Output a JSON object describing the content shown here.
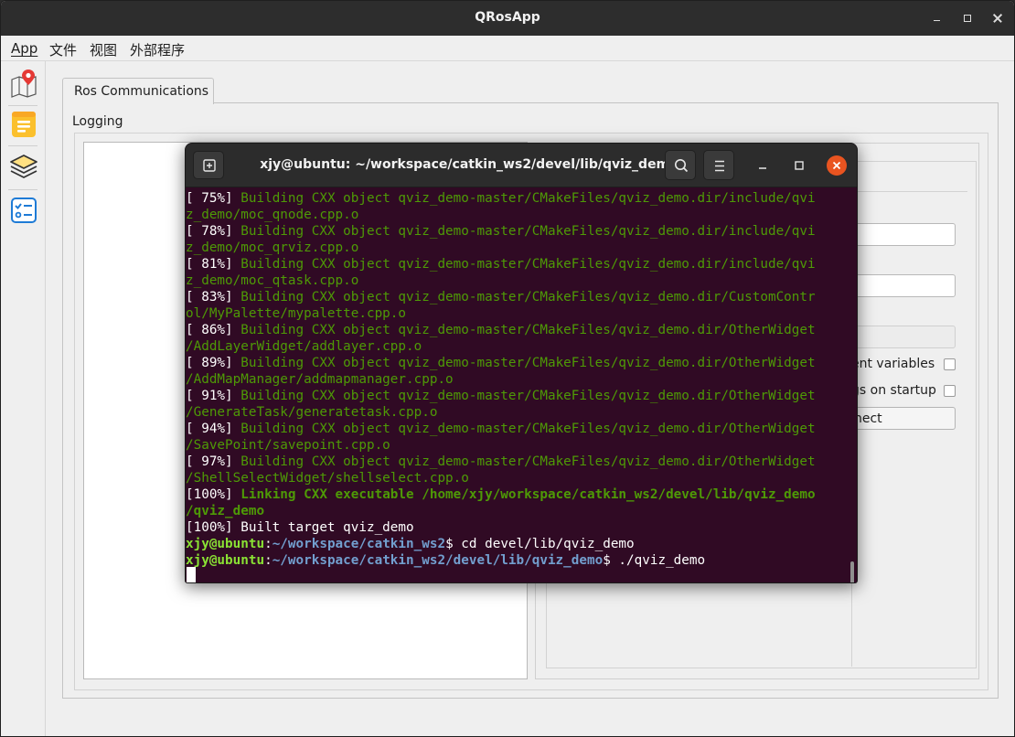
{
  "app": {
    "title": "QRosApp",
    "menu": [
      "App",
      "文件",
      "视图",
      "外部程序"
    ],
    "tab_label": "Ros Communications",
    "logging_label": "Logging",
    "env_checkbox_label": "ent variables",
    "startup_checkbox_label": "gs on startup",
    "connect_label": "nect",
    "env_checked": false,
    "startup_checked": false,
    "toolbar_icons": [
      "map-pin-icon",
      "notes-icon",
      "layers-icon",
      "checklist-icon"
    ],
    "colors": {
      "titlebar": "#2d2d2d",
      "window": "#efefef"
    }
  },
  "terminal": {
    "title": "xjy@ubuntu: ~/workspace/catkin_ws2/devel/lib/qviz_demo",
    "colors": {
      "background": "#300a24",
      "green": "#4e9a06",
      "prompt_user": "#8ae234",
      "prompt_path": "#729fcf",
      "close": "#e95420"
    },
    "lines": [
      [
        {
          "t": "[ 75%] ",
          "c": "w"
        },
        {
          "t": "Building CXX object qviz_demo-master/CMakeFiles/qviz_demo.dir/include/qvi",
          "c": "g"
        }
      ],
      [
        {
          "t": "z_demo/moc_qnode.cpp.o",
          "c": "g"
        }
      ],
      [
        {
          "t": "[ 78%] ",
          "c": "w"
        },
        {
          "t": "Building CXX object qviz_demo-master/CMakeFiles/qviz_demo.dir/include/qvi",
          "c": "g"
        }
      ],
      [
        {
          "t": "z_demo/moc_qrviz.cpp.o",
          "c": "g"
        }
      ],
      [
        {
          "t": "[ 81%] ",
          "c": "w"
        },
        {
          "t": "Building CXX object qviz_demo-master/CMakeFiles/qviz_demo.dir/include/qvi",
          "c": "g"
        }
      ],
      [
        {
          "t": "z_demo/moc_qtask.cpp.o",
          "c": "g"
        }
      ],
      [
        {
          "t": "[ 83%] ",
          "c": "w"
        },
        {
          "t": "Building CXX object qviz_demo-master/CMakeFiles/qviz_demo.dir/CustomContr",
          "c": "g"
        }
      ],
      [
        {
          "t": "ol/MyPalette/mypalette.cpp.o",
          "c": "g"
        }
      ],
      [
        {
          "t": "[ 86%] ",
          "c": "w"
        },
        {
          "t": "Building CXX object qviz_demo-master/CMakeFiles/qviz_demo.dir/OtherWidget",
          "c": "g"
        }
      ],
      [
        {
          "t": "/AddLayerWidget/addlayer.cpp.o",
          "c": "g"
        }
      ],
      [
        {
          "t": "[ 89%] ",
          "c": "w"
        },
        {
          "t": "Building CXX object qviz_demo-master/CMakeFiles/qviz_demo.dir/OtherWidget",
          "c": "g"
        }
      ],
      [
        {
          "t": "/AddMapManager/addmapmanager.cpp.o",
          "c": "g"
        }
      ],
      [
        {
          "t": "[ 91%] ",
          "c": "w"
        },
        {
          "t": "Building CXX object qviz_demo-master/CMakeFiles/qviz_demo.dir/OtherWidget",
          "c": "g"
        }
      ],
      [
        {
          "t": "/GenerateTask/generatetask.cpp.o",
          "c": "g"
        }
      ],
      [
        {
          "t": "[ 94%] ",
          "c": "w"
        },
        {
          "t": "Building CXX object qviz_demo-master/CMakeFiles/qviz_demo.dir/OtherWidget",
          "c": "g"
        }
      ],
      [
        {
          "t": "/SavePoint/savepoint.cpp.o",
          "c": "g"
        }
      ],
      [
        {
          "t": "[ 97%] ",
          "c": "w"
        },
        {
          "t": "Building CXX object qviz_demo-master/CMakeFiles/qviz_demo.dir/OtherWidget",
          "c": "g"
        }
      ],
      [
        {
          "t": "/ShellSelectWidget/shellselect.cpp.o",
          "c": "g"
        }
      ],
      [
        {
          "t": "[100%] ",
          "c": "w"
        },
        {
          "t": "Linking CXX executable /home/xjy/workspace/catkin_ws2/devel/lib/qviz_demo",
          "c": "gb"
        }
      ],
      [
        {
          "t": "/qviz_demo",
          "c": "gb"
        }
      ],
      [
        {
          "t": "[100%] Built target qviz_demo",
          "c": "w"
        }
      ],
      [
        {
          "t": "xjy@ubuntu",
          "c": "u"
        },
        {
          "t": ":",
          "c": "w"
        },
        {
          "t": "~/workspace/catkin_ws2",
          "c": "p"
        },
        {
          "t": "$ cd devel/lib/qviz_demo",
          "c": "w"
        }
      ],
      [
        {
          "t": "xjy@ubuntu",
          "c": "u"
        },
        {
          "t": ":",
          "c": "w"
        },
        {
          "t": "~/workspace/catkin_ws2/devel/lib/qviz_demo",
          "c": "p"
        },
        {
          "t": "$ ./qviz_demo",
          "c": "w"
        }
      ]
    ]
  }
}
